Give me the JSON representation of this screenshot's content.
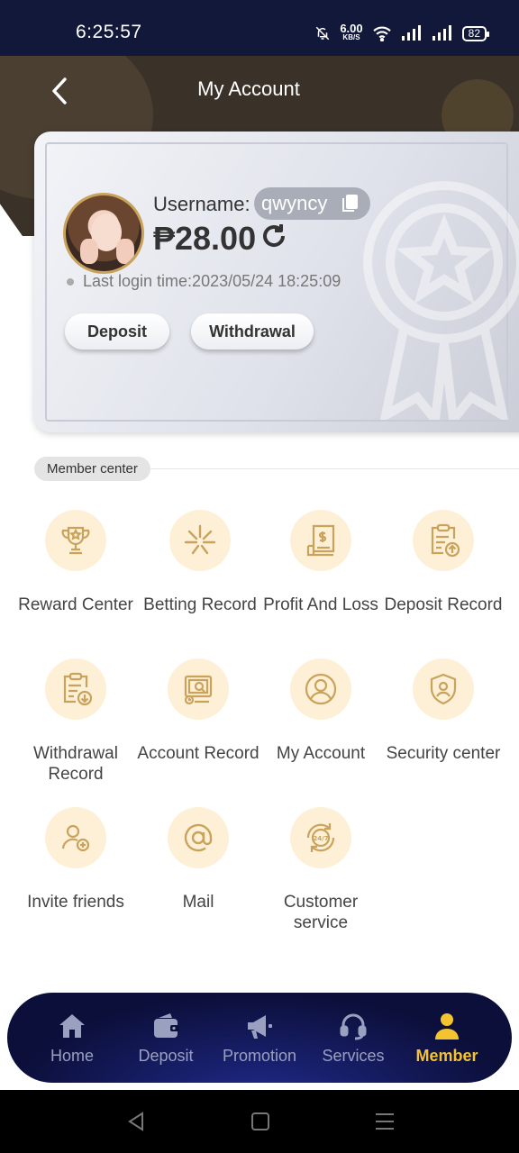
{
  "status_bar": {
    "time": "6:25:57",
    "speed_value": "6.00",
    "speed_unit": "KB/S",
    "battery": "82"
  },
  "header": {
    "title": "My Account"
  },
  "account": {
    "username_label": "Username:",
    "username": "qwyncy",
    "balance": "₱28.00",
    "last_login": "Last login time:2023/05/24 18:25:09",
    "deposit_label": "Deposit",
    "withdrawal_label": "Withdrawal"
  },
  "member_center": {
    "title": "Member center",
    "items": [
      {
        "label": "Reward Center",
        "icon": "trophy-icon"
      },
      {
        "label": "Betting Record",
        "icon": "stars-icon"
      },
      {
        "label": "Profit And Loss",
        "icon": "money-document-icon"
      },
      {
        "label": "Deposit Record",
        "icon": "clipboard-up-icon"
      },
      {
        "label": "Withdrawal Record",
        "icon": "clipboard-down-icon"
      },
      {
        "label": "Account Record",
        "icon": "monitor-search-icon"
      },
      {
        "label": "My Account",
        "icon": "user-icon"
      },
      {
        "label": "Security center",
        "icon": "shield-user-icon"
      },
      {
        "label": "Invite friends",
        "icon": "user-plus-icon"
      },
      {
        "label": "Mail",
        "icon": "at-icon"
      },
      {
        "label": "Customer service",
        "icon": "24-7-icon"
      }
    ]
  },
  "bottom_nav": {
    "items": [
      {
        "label": "Home",
        "icon": "home-icon"
      },
      {
        "label": "Deposit",
        "icon": "wallet-icon"
      },
      {
        "label": "Promotion",
        "icon": "megaphone-icon"
      },
      {
        "label": "Services",
        "icon": "headset-icon"
      },
      {
        "label": "Member",
        "icon": "member-icon"
      }
    ],
    "active": "Member",
    "active_color": "#f4c430"
  },
  "colors": {
    "accent": "#c9a35c",
    "icon_bg": "#fdf0d6",
    "nav_bg": "#0c0f3a"
  }
}
